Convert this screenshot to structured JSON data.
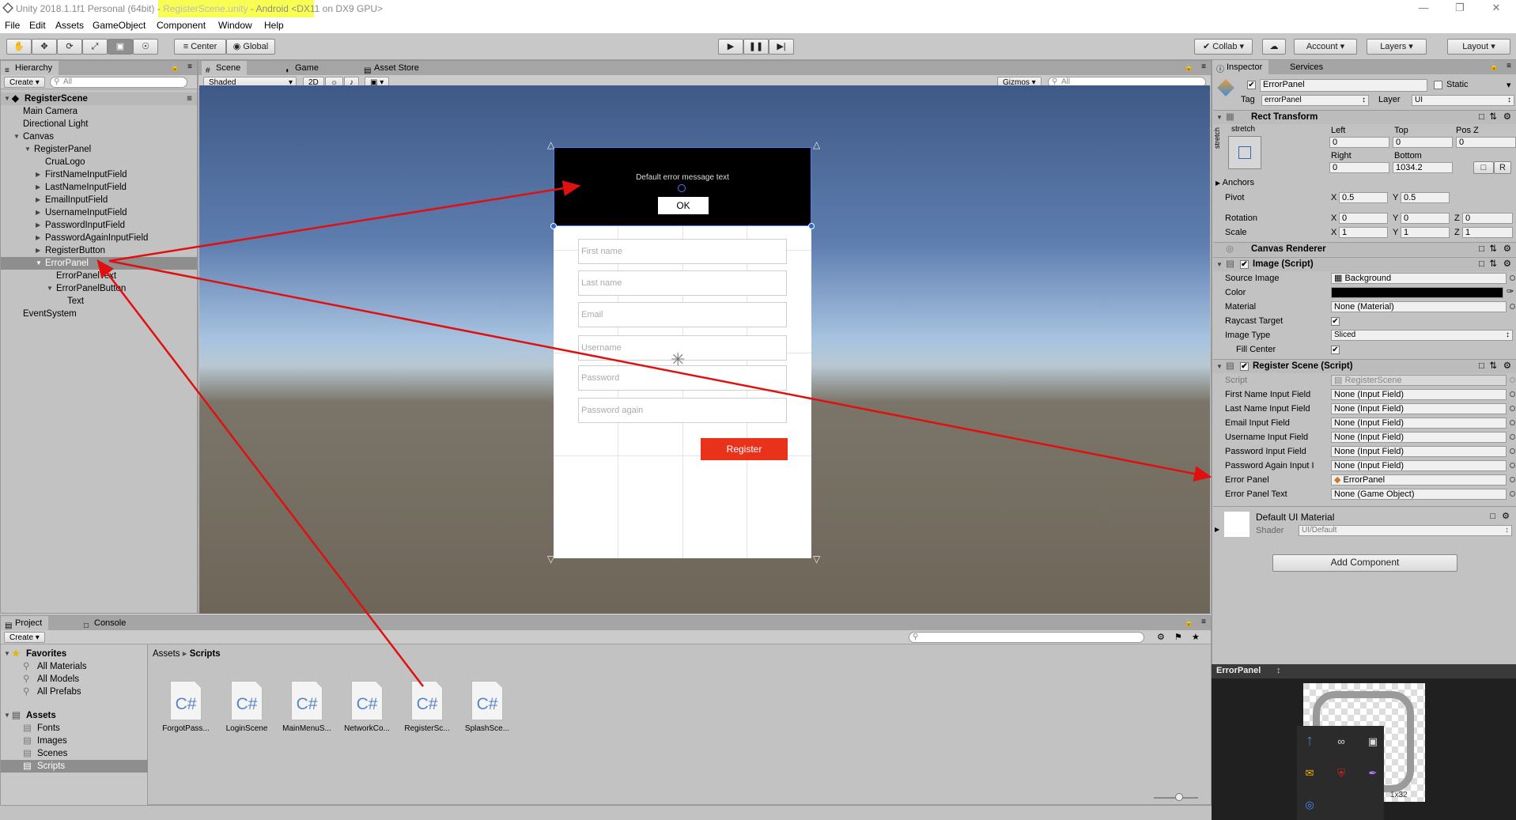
{
  "window": {
    "title_prefix": "Unity 2018.1.1f1 Personal (64bit) - ",
    "title_scene": "RegisterScene.unity",
    "title_suffix": " - Android <DX11 on DX9 GPU>",
    "highlight_color": "#f9ff52"
  },
  "menu": [
    "File",
    "Edit",
    "Assets",
    "GameObject",
    "Component",
    "Window",
    "Help"
  ],
  "toolbar": {
    "pivot_label": "Center",
    "space_label": "Global",
    "collab_label": "Collab",
    "account_label": "Account",
    "layers_label": "Layers",
    "layout_label": "Layout"
  },
  "hierarchy": {
    "tab": "Hierarchy",
    "create": "Create",
    "search_placeholder": "All",
    "scene": "RegisterScene",
    "items": [
      {
        "label": "Main Camera"
      },
      {
        "label": "Directional Light"
      },
      {
        "label": "Canvas"
      },
      {
        "label": "RegisterPanel"
      },
      {
        "label": "CruaLogo"
      },
      {
        "label": "FirstNameInputField"
      },
      {
        "label": "LastNameInputField"
      },
      {
        "label": "EmailInputField"
      },
      {
        "label": "UsernameInputField"
      },
      {
        "label": "PasswordInputField"
      },
      {
        "label": "PasswordAgainInputField"
      },
      {
        "label": "RegisterButton"
      },
      {
        "label": "ErrorPanel"
      },
      {
        "label": "ErrorPanelText"
      },
      {
        "label": "ErrorPanelButton"
      },
      {
        "label": "Text"
      },
      {
        "label": "EventSystem"
      }
    ]
  },
  "scene": {
    "tabs": [
      "Scene",
      "Game",
      "Asset Store"
    ],
    "shading": "Shaded",
    "mode_2d": "2D",
    "gizmos": "Gizmos",
    "search_placeholder": "All",
    "error_text": "Default error message text",
    "ok_label": "OK",
    "placeholders": [
      "First name",
      "Last name",
      "Email",
      "Username",
      "Password",
      "Password again"
    ],
    "register_label": "Register",
    "register_color": "#e8321b"
  },
  "project": {
    "tabs": [
      "Project",
      "Console"
    ],
    "create": "Create",
    "breadcrumb_root": "Assets",
    "breadcrumb_current": "Scripts",
    "favorites_label": "Favorites",
    "favorites": [
      "All Materials",
      "All Models",
      "All Prefabs"
    ],
    "assets_label": "Assets",
    "folders": [
      "Fonts",
      "Images",
      "Scenes",
      "Scripts"
    ],
    "files": [
      "ForgotPass...",
      "LoginScene",
      "MainMenuS...",
      "NetworkCo...",
      "RegisterSc...",
      "SplashSce..."
    ],
    "file_glyph": "C#"
  },
  "inspector": {
    "tabs": [
      "Inspector",
      "Services"
    ],
    "object_name": "ErrorPanel",
    "static_label": "Static",
    "tag_label": "Tag",
    "tag_value": "errorPanel",
    "layer_label": "Layer",
    "layer_value": "UI",
    "rect_transform": {
      "header": "Rect Transform",
      "anchor_preset": "stretch",
      "anchor_side": "stretch",
      "left_label": "Left",
      "left": "0",
      "top_label": "Top",
      "top": "0",
      "posz_label": "Pos Z",
      "posz": "0",
      "right_label": "Right",
      "right": "0",
      "bottom_label": "Bottom",
      "bottom": "1034.2",
      "r_button": "R",
      "anchors_label": "Anchors",
      "pivot_label": "Pivot",
      "pivot_x": "0.5",
      "pivot_y": "0.5",
      "rotation_label": "Rotation",
      "rot_x": "0",
      "rot_y": "0",
      "rot_z": "0",
      "scale_label": "Scale",
      "scale_x": "1",
      "scale_y": "1",
      "scale_z": "1"
    },
    "canvas_renderer": "Canvas Renderer",
    "image": {
      "header": "Image (Script)",
      "source_label": "Source Image",
      "source_value": "Background",
      "color_label": "Color",
      "color_value": "#000000",
      "material_label": "Material",
      "material_value": "None (Material)",
      "raycast_label": "Raycast Target",
      "type_label": "Image Type",
      "type_value": "Sliced",
      "fill_label": "Fill Center"
    },
    "register_script": {
      "header": "Register Scene (Script)",
      "script_label": "Script",
      "script_value": "RegisterScene",
      "fields": [
        {
          "label": "First Name Input Field",
          "value": "None (Input Field)"
        },
        {
          "label": "Last Name Input Field",
          "value": "None (Input Field)"
        },
        {
          "label": "Email Input Field",
          "value": "None (Input Field)"
        },
        {
          "label": "Username Input Field",
          "value": "None (Input Field)"
        },
        {
          "label": "Password Input Field",
          "value": "None (Input Field)"
        },
        {
          "label": "Password Again Input I",
          "value": "None (Input Field)"
        },
        {
          "label": "Error Panel",
          "value": "ErrorPanel"
        },
        {
          "label": "Error Panel Text",
          "value": "None (Game Object)"
        }
      ]
    },
    "material": {
      "name": "Default UI Material",
      "shader_label": "Shader",
      "shader_value": "UI/Default"
    },
    "add_component": "Add Component",
    "preview_title": "ErrorPanel",
    "preview_size": "1x32"
  }
}
